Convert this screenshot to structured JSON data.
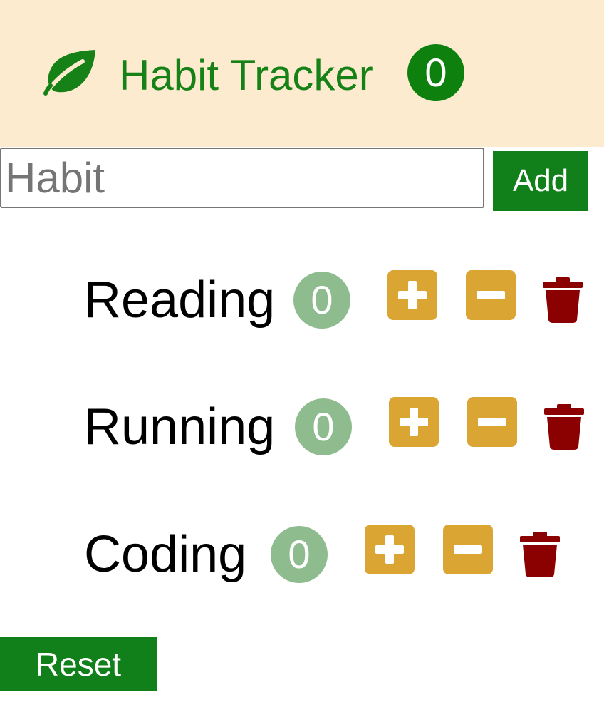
{
  "header": {
    "logo_icon": "leaf-icon",
    "title": "Habit Tracker",
    "total_count": "0"
  },
  "form": {
    "placeholder": "Habit",
    "value": "",
    "add_label": "Add"
  },
  "habits": [
    {
      "name": "Reading",
      "count": "0"
    },
    {
      "name": "Running",
      "count": "0"
    },
    {
      "name": "Coding",
      "count": "0"
    }
  ],
  "icons": {
    "increment": "plus-square-icon",
    "decrement": "minus-square-icon",
    "delete": "trash-icon"
  },
  "reset_label": "Reset",
  "colors": {
    "header_bg": "#fdebd0",
    "brand_green": "#168116",
    "button_green": "#11801a",
    "count_badge": "#8fbc8f",
    "action_gold": "#daa532",
    "delete_red": "#8b0000"
  }
}
